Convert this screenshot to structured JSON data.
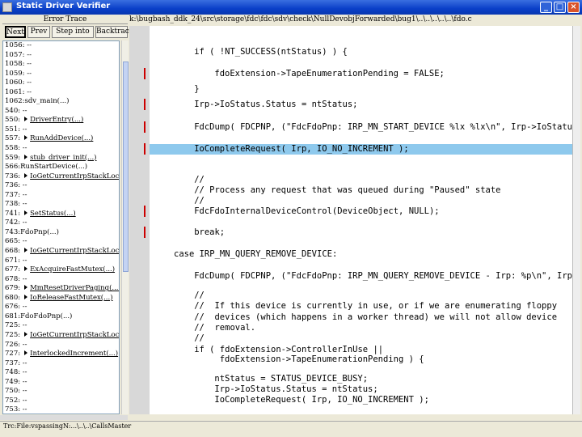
{
  "window": {
    "title": "Static Driver Verifier",
    "minimize": "_",
    "maximize": "□",
    "close": "×"
  },
  "left_pane": {
    "header": "Error Trace",
    "toolbar": [
      "Next",
      "Prev",
      "Step into",
      "Backtrack"
    ],
    "rows": [
      {
        "text": "1056: --"
      },
      {
        "text": "1057: --"
      },
      {
        "text": "1058: --"
      },
      {
        "text": "1059: --"
      },
      {
        "text": "1060: --"
      },
      {
        "text": "1061: --"
      },
      {
        "text": "1062:sdv_main(...)"
      },
      {
        "text": "540: --"
      },
      {
        "text": "550:",
        "call": "DriverEntry(...)"
      },
      {
        "text": "551: --"
      },
      {
        "text": "557:",
        "call": "RunAddDevice(...)"
      },
      {
        "text": "558: --"
      },
      {
        "text": "559:",
        "call": "stub_driver_init(...)"
      },
      {
        "text": "566:RunStartDevice(...)"
      },
      {
        "text": "736:",
        "call": "IoGetCurrentIrpStackLoca"
      },
      {
        "text": "736: --"
      },
      {
        "text": "737: --"
      },
      {
        "text": "738: --"
      },
      {
        "text": "741:",
        "call": "SetStatus(...)"
      },
      {
        "text": "742: --"
      },
      {
        "text": "743:FdoPnp(...)"
      },
      {
        "text": "665: --"
      },
      {
        "text": "668:",
        "call": "IoGetCurrentIrpStackLoca"
      },
      {
        "text": "671: --"
      },
      {
        "text": "677:",
        "call": "ExAcquireFastMutex(...)"
      },
      {
        "text": "678: --"
      },
      {
        "text": "679:",
        "call": "MmResetDriverPaging(...)"
      },
      {
        "text": "680:",
        "call": "IoReleaseFastMutex(...)"
      },
      {
        "text": "676: --"
      },
      {
        "text": "681:FdoFdoPnp(...)"
      },
      {
        "text": "725: --"
      },
      {
        "text": "725:",
        "call": "IoGetCurrentIrpStackLoca"
      },
      {
        "text": "726: --"
      },
      {
        "text": "727:",
        "call": "InterlockedIncrement(...)"
      },
      {
        "text": "737: --"
      },
      {
        "text": "748: --"
      },
      {
        "text": "749: --"
      },
      {
        "text": "750: --"
      },
      {
        "text": "752: --"
      },
      {
        "text": "753: --"
      }
    ]
  },
  "path": "k:\\bugbash_ddk_24\\src\\storage\\fdc\\fdc\\sdv\\check\\NullDevobjForwarded\\bug1\\..\\..\\..\\..\\..\\fdo.c",
  "code_lines": [
    {
      "indent": 4,
      "text": "if ( !NT_SUCCESS(ntStatus) ) {",
      "mark": false,
      "hl": false
    },
    {
      "indent": 8,
      "text": "fdoExtension->TapeEnumerationPending = FALSE;",
      "mark": true,
      "hl": false
    },
    {
      "indent": 4,
      "text": "}",
      "mark": false,
      "hl": false
    },
    {
      "indent": 4,
      "text": "Irp->IoStatus.Status = ntStatus;",
      "mark": true,
      "hl": false
    },
    {
      "indent": 4,
      "text": "FdcDump( FDCPNP, (\"FdcFdoPnp: IRP_MN_START_DEVICE %lx %lx\\n\", Irp->IoStatus.Status, Irp->IoStatus.Information) );",
      "mark": true,
      "hl": false
    },
    {
      "indent": 4,
      "text": "IoCompleteRequest( Irp, IO_NO_INCREMENT );",
      "mark": true,
      "hl": true
    },
    {
      "indent": 4,
      "text": "//",
      "mark": false,
      "hl": false
    },
    {
      "indent": 4,
      "text": "// Process any request that was queued during \"Paused\" state",
      "mark": false,
      "hl": false
    },
    {
      "indent": 4,
      "text": "//",
      "mark": false,
      "hl": false
    },
    {
      "indent": 4,
      "text": "FdcFdoInternalDeviceControl(DeviceObject, NULL);",
      "mark": true,
      "hl": false
    },
    {
      "indent": 4,
      "text": "break;",
      "mark": true,
      "hl": false
    },
    {
      "indent": 0,
      "text": "case IRP_MN_QUERY_REMOVE_DEVICE:",
      "mark": false,
      "hl": false
    },
    {
      "indent": 4,
      "text": "FdcDump( FDCPNP, (\"FdcFdoPnp: IRP_MN_QUERY_REMOVE_DEVICE - Irp: %p\\n\", Irp) );",
      "mark": false,
      "hl": false
    },
    {
      "indent": 4,
      "text": "//",
      "mark": false,
      "hl": false
    },
    {
      "indent": 4,
      "text": "//  If this device is currently in use, or if we are enumerating floppy",
      "mark": false,
      "hl": false
    },
    {
      "indent": 4,
      "text": "//  devices (which happens in a worker thread) we will not allow device",
      "mark": false,
      "hl": false
    },
    {
      "indent": 4,
      "text": "//  removal.",
      "mark": false,
      "hl": false
    },
    {
      "indent": 4,
      "text": "//",
      "mark": false,
      "hl": false
    },
    {
      "indent": 4,
      "text": "if ( fdoExtension->ControllerInUse ||",
      "mark": false,
      "hl": false
    },
    {
      "indent": 9,
      "text": "fdoExtension->TapeEnumerationPending ) {",
      "mark": false,
      "hl": false
    },
    {
      "indent": 8,
      "text": "ntStatus = STATUS_DEVICE_BUSY;",
      "mark": false,
      "hl": false
    },
    {
      "indent": 8,
      "text": "Irp->IoStatus.Status = ntStatus;",
      "mark": false,
      "hl": false
    },
    {
      "indent": 8,
      "text": "IoCompleteRequest( Irp, IO_NO_INCREMENT );",
      "mark": false,
      "hl": false
    }
  ],
  "status_text": "Trc:File:vspassingN:...\\..\\..\\CallsMaster",
  "colors": {
    "highlight": "#8ec9ed",
    "marker": "#cc0000",
    "titlebar": "#0a3fc8"
  }
}
